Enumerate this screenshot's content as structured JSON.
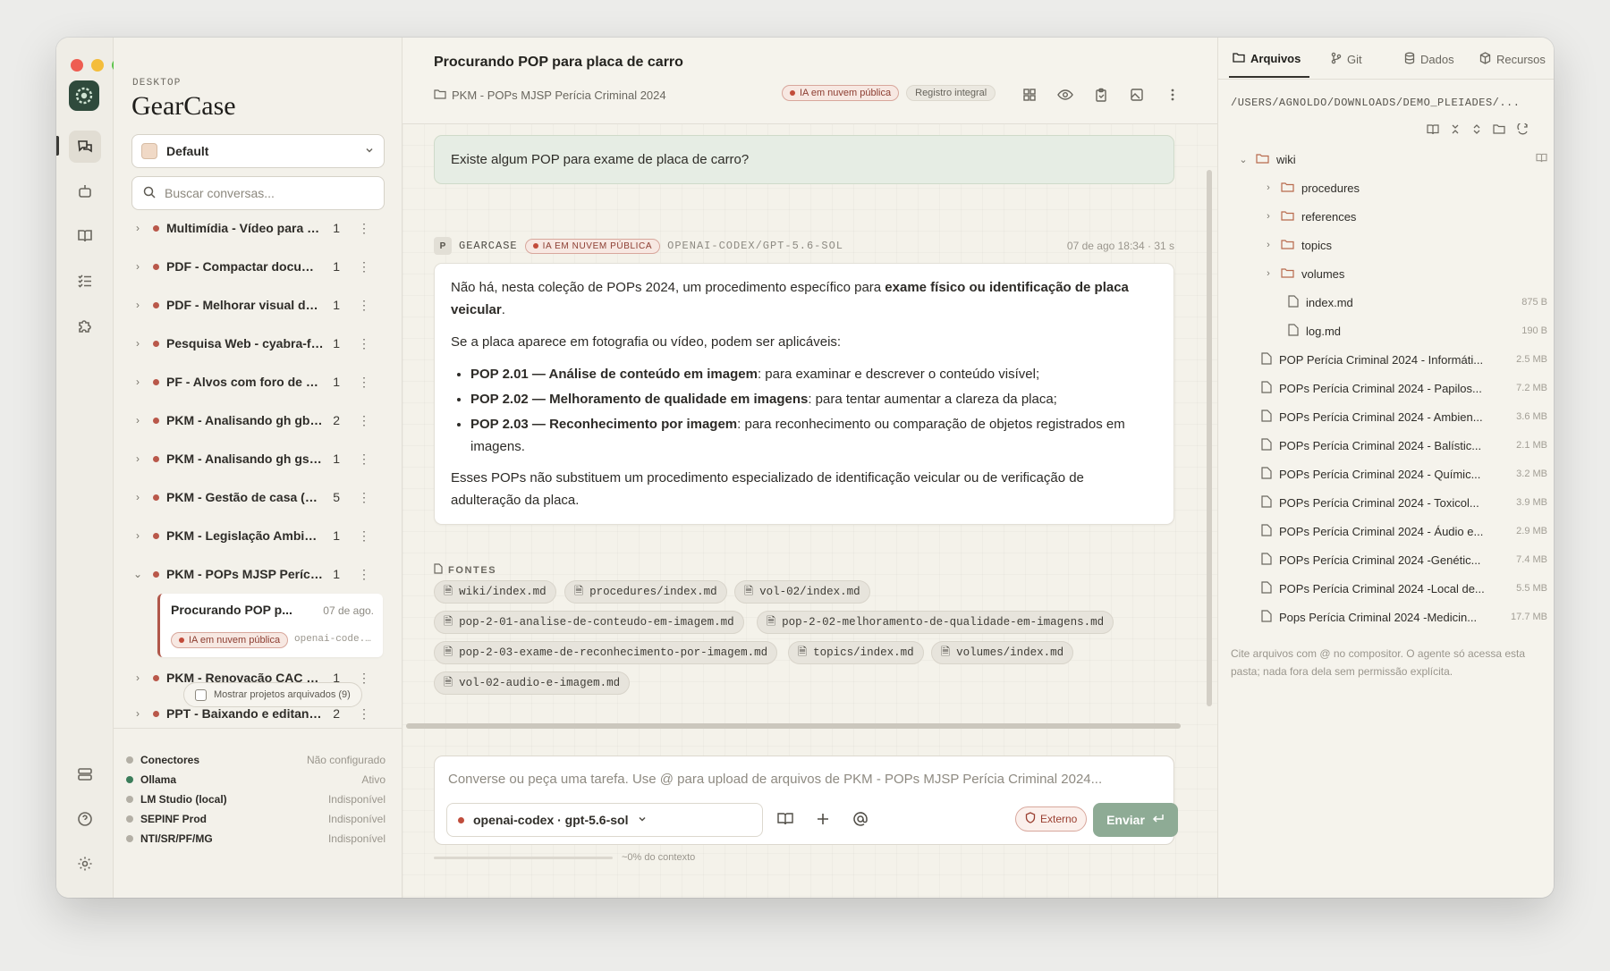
{
  "app": {
    "section_label": "DESKTOP",
    "name": "GearCase"
  },
  "sidebar": {
    "profile": "Default",
    "search_placeholder": "Buscar conversas...",
    "conversations": [
      {
        "title": "Multimídia - Vídeo para á...",
        "count": "1"
      },
      {
        "title": "PDF - Compactar docume...",
        "count": "1"
      },
      {
        "title": "PDF - Melhorar visual de ...",
        "count": "1"
      },
      {
        "title": "Pesquisa Web - cyabra-fa...",
        "count": "1"
      },
      {
        "title": "PF - Alvos com foro de pr...",
        "count": "1"
      },
      {
        "title": "PKM - Analisando gh gbra...",
        "count": "2"
      },
      {
        "title": "PKM - Analisando gh gsta...",
        "count": "1"
      },
      {
        "title": "PKM - Gestão de casa (Cl...",
        "count": "5"
      },
      {
        "title": "PKM - Legislação Ambien...",
        "count": "1"
      },
      {
        "title": "PKM - POPs MJSP Perícia...",
        "count": "1"
      },
      {
        "title": "PKM - Renovação CAC e ...",
        "count": "1"
      },
      {
        "title": "PPT - Baixando e editand...",
        "count": "2"
      }
    ],
    "active_sub": {
      "title": "Procurando POP p...",
      "date": "07 de ago.",
      "badge": "IA em nuvem pública",
      "model": "openai-code..."
    },
    "archived_toggle": "Mostrar projetos arquivados (9)",
    "connectors": [
      {
        "name": "Conectores",
        "status": "Não configurado",
        "color": "#b3afa5"
      },
      {
        "name": "Ollama",
        "status": "Ativo",
        "color": "#3b7d5a"
      },
      {
        "name": "LM Studio (local)",
        "status": "Indisponível",
        "color": "#b3afa5"
      },
      {
        "name": "SEPINF Prod",
        "status": "Indisponível",
        "color": "#b3afa5"
      },
      {
        "name": "NTI/SR/PF/MG",
        "status": "Indisponível",
        "color": "#b3afa5"
      }
    ]
  },
  "chat": {
    "title": "Procurando POP para placa de carro",
    "project": "PKM - POPs MJSP Perícia Criminal 2024",
    "badge_cloud": "IA em nuvem pública",
    "badge_log": "Registro integral",
    "user_message": "Existe algum POP para exame de placa de carro?",
    "assistant": {
      "avatar": "P",
      "name": "GEARCASE",
      "badge": "IA em nuvem pública",
      "model": "OPENAI-CODEX/GPT-5.6-SOL",
      "time": "07 de ago 18:34 · 31 s",
      "p1_pre": "Não há, nesta coleção de POPs 2024, um procedimento específico para ",
      "p1_bold": "exame físico ou identificação de placa veicular",
      "p1_post": ".",
      "p2": "Se a placa aparece em fotografia ou vídeo, podem ser aplicáveis:",
      "bullets": [
        {
          "bold": "POP 2.01 — Análise de conteúdo em imagem",
          "text": ": para examinar e descrever o conteúdo visível;"
        },
        {
          "bold": "POP 2.02 — Melhoramento de qualidade em imagens",
          "text": ": para tentar aumentar a clareza da placa;"
        },
        {
          "bold": "POP 2.03 — Reconhecimento por imagem",
          "text": ": para reconhecimento ou comparação de objetos registrados em imagens."
        }
      ],
      "p3": "Esses POPs não substituem um procedimento especializado de identificação veicular ou de verificação de adulteração da placa."
    },
    "sources_label": "FONTES",
    "sources": [
      "wiki/index.md",
      "procedures/index.md",
      "vol-02/index.md",
      "pop-2-01-analise-de-conteudo-em-imagem.md",
      "pop-2-02-melhoramento-de-qualidade-em-imagens.md",
      "pop-2-03-exame-de-reconhecimento-por-imagem.md",
      "topics/index.md",
      "volumes/index.md",
      "vol-02-audio-e-imagem.md"
    ],
    "composer_placeholder": "Converse ou peça uma tarefa. Use @ para upload de arquivos de PKM - POPs MJSP Perícia Criminal 2024...",
    "model_select": "openai-codex · gpt-5.6-sol",
    "external": "Externo",
    "send": "Enviar",
    "context": "~0% do contexto"
  },
  "right": {
    "tabs": [
      "Arquivos",
      "Git",
      "Dados",
      "Recursos"
    ],
    "path": "/USERS/AGNOLDO/DOWNLOADS/DEMO_PLEIADES/...",
    "tree": [
      {
        "name": "wiki",
        "type": "folder",
        "expanded": true,
        "size": ""
      },
      {
        "name": "procedures",
        "type": "folder",
        "size": ""
      },
      {
        "name": "references",
        "type": "folder",
        "size": ""
      },
      {
        "name": "topics",
        "type": "folder",
        "size": ""
      },
      {
        "name": "volumes",
        "type": "folder",
        "size": ""
      },
      {
        "name": "index.md",
        "type": "file",
        "size": "875 B"
      },
      {
        "name": "log.md",
        "type": "file",
        "size": "190 B"
      },
      {
        "name": "POP Perícia Criminal 2024 - Informáti...",
        "type": "file",
        "size": "2.5 MB"
      },
      {
        "name": "POPs Perícia Criminal 2024 - Papilos...",
        "type": "file",
        "size": "7.2 MB"
      },
      {
        "name": "POPs Perícia Criminal 2024 - Ambien...",
        "type": "file",
        "size": "3.6 MB"
      },
      {
        "name": "POPs Perícia Criminal 2024 - Balístic...",
        "type": "file",
        "size": "2.1 MB"
      },
      {
        "name": "POPs Perícia Criminal 2024 - Químic...",
        "type": "file",
        "size": "3.2 MB"
      },
      {
        "name": "POPs Perícia Criminal 2024 - Toxicol...",
        "type": "file",
        "size": "3.9 MB"
      },
      {
        "name": "POPs Perícia Criminal 2024 - Áudio e...",
        "type": "file",
        "size": "2.9 MB"
      },
      {
        "name": "POPs Perícia Criminal 2024 -Genétic...",
        "type": "file",
        "size": "7.4 MB"
      },
      {
        "name": "POPs Perícia Criminal 2024 -Local de...",
        "type": "file",
        "size": "5.5 MB"
      },
      {
        "name": "Pops Perícia Criminal 2024 -Medicin...",
        "type": "file",
        "size": "17.7 MB"
      }
    ],
    "note": "Cite arquivos com @ no compositor. O agente só acessa esta pasta; nada fora dela sem permissão explícita."
  }
}
